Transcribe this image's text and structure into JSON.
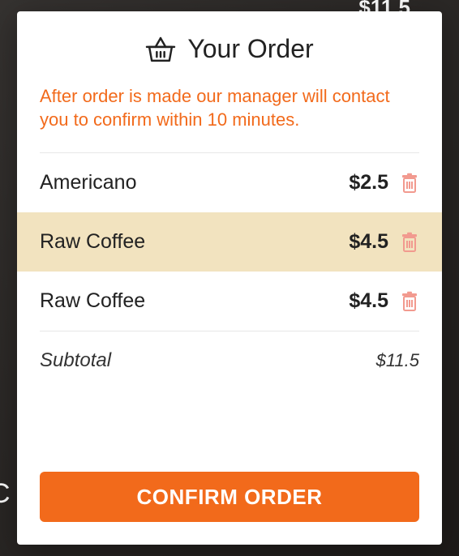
{
  "background": {
    "partial_price": "$11.5",
    "partial_letter": "C"
  },
  "header": {
    "title": "Your Order"
  },
  "notice": "After order is made our manager will contact you to confirm within 10 minutes.",
  "items": [
    {
      "name": "Americano",
      "price": "$2.5",
      "highlight": false
    },
    {
      "name": "Raw Coffee",
      "price": "$4.5",
      "highlight": true
    },
    {
      "name": "Raw Coffee",
      "price": "$4.5",
      "highlight": false
    }
  ],
  "subtotal": {
    "label": "Subtotal",
    "value": "$11.5"
  },
  "confirm_label": "CONFIRM ORDER"
}
